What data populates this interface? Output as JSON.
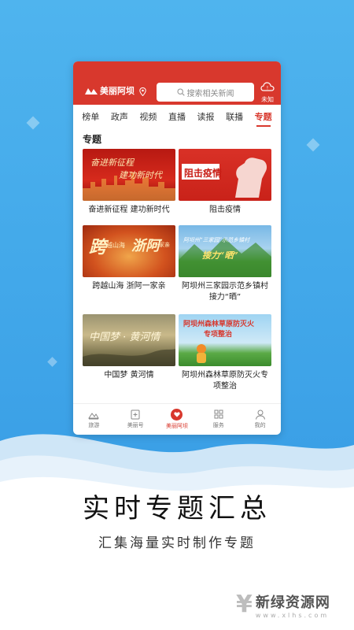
{
  "app": {
    "logo_text": "美丽阿坝",
    "search_placeholder": "搜索相关新闻",
    "weather_label": "未知",
    "tabs": [
      "榜单",
      "政声",
      "视频",
      "直播",
      "读报",
      "联播",
      "专题"
    ],
    "active_tab": "专题",
    "section_title": "专题",
    "cards": [
      {
        "title": "奋进新征程 建功新时代",
        "img_text_1": "奋进新征程",
        "img_text_2": "建功新时代"
      },
      {
        "title": "阻击疫情",
        "img_text_1": "阻击疫情"
      },
      {
        "title": "跨越山海 浙阿一家亲",
        "img_text_1": "跨",
        "img_text_2": "越山海",
        "img_text_3": "浙阿",
        "img_text_4": "一家亲"
      },
      {
        "title": "阿坝州三家园示范乡镇村接力“晒”",
        "img_text_1": "阿坝州“三家园”示范乡镇村",
        "img_text_2": "接力“晒”"
      },
      {
        "title": "中国梦 黄河情",
        "img_text_1": "中国梦 · 黄河情"
      },
      {
        "title": "阿坝州森林草原防灭火专项整治",
        "img_text_1": "阿坝州森林草原防灭火",
        "img_text_2": "专项整治"
      }
    ],
    "nav": [
      {
        "label": "旅游",
        "icon": "mountain-icon"
      },
      {
        "label": "美丽号",
        "icon": "plus-square-icon"
      },
      {
        "label": "美丽阿坝",
        "icon": "heart-icon"
      },
      {
        "label": "服务",
        "icon": "grid-icon"
      },
      {
        "label": "我的",
        "icon": "user-icon"
      }
    ]
  },
  "promo": {
    "headline": "实时专题汇总",
    "subline": "汇集海量实时制作专题"
  },
  "watermark": {
    "title": "新绿资源网",
    "url": "www.xlhs.com"
  },
  "colors": {
    "brand_red": "#d8382d",
    "sky_blue": "#4fb4ee"
  }
}
